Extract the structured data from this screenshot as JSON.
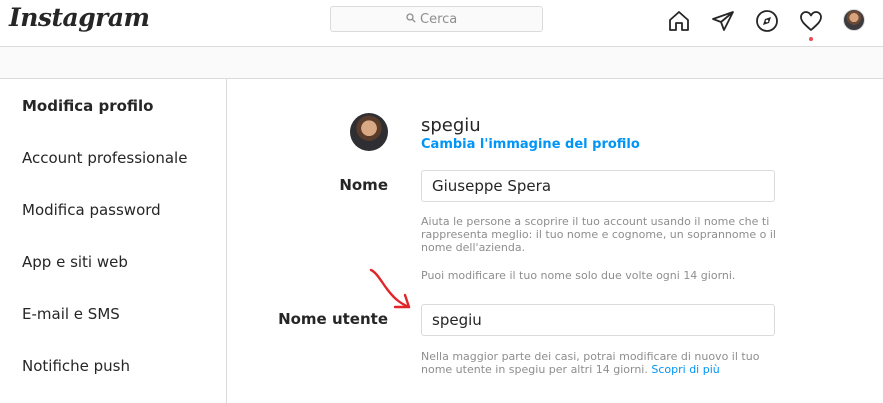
{
  "header": {
    "logo": "Instagram",
    "search_placeholder": "Cerca"
  },
  "sidebar": {
    "items": [
      {
        "label": "Modifica profilo"
      },
      {
        "label": "Account professionale"
      },
      {
        "label": "Modifica password"
      },
      {
        "label": "App e siti web"
      },
      {
        "label": "E-mail e SMS"
      },
      {
        "label": "Notifiche push"
      }
    ]
  },
  "profile": {
    "username": "spegiu",
    "change_photo": "Cambia l'immagine del profilo"
  },
  "form": {
    "name_label": "Nome",
    "name_value": "Giuseppe Spera",
    "name_help": "Aiuta le persone a scoprire il tuo account usando il nome che ti rappresenta meglio: il tuo nome e cognome, un soprannome o il nome dell'azienda.",
    "name_limit": "Puoi modificare il tuo nome solo due volte ogni 14 giorni.",
    "username_label": "Nome utente",
    "username_value": "spegiu",
    "username_help": "Nella maggior parte dei casi, potrai modificare di nuovo il tuo nome utente in spegiu per altri 14 giorni.",
    "username_help_link": "Scopri di più"
  },
  "colors": {
    "accent": "#0095f6",
    "annotation_arrow": "#e0262a",
    "notification_dot": "#ed4956"
  }
}
